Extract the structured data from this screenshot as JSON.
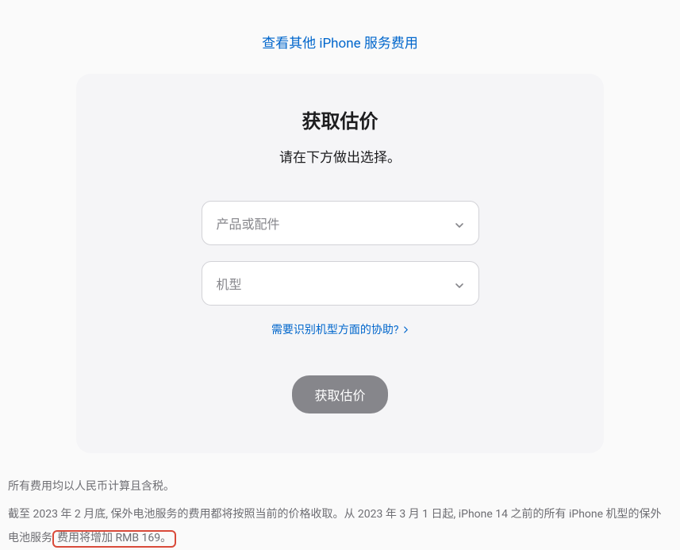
{
  "topLink": {
    "label": "查看其他 iPhone 服务费用"
  },
  "card": {
    "title": "获取估价",
    "subtitle": "请在下方做出选择。",
    "select1": {
      "placeholder": "产品或配件"
    },
    "select2": {
      "placeholder": "机型"
    },
    "helpLink": "需要识别机型方面的协助?",
    "button": "获取估价"
  },
  "footer": {
    "line1": "所有费用均以人民币计算且含税。",
    "line2_part1": "截至 2023 年 2 月底, 保外电池服务的费用都将按照当前的价格收取。从 2023 年 3 月 1 日起, iPhone 14 之前的所有 iPhone 机型的保外电池服务",
    "line2_highlight": "费用将增加 RMB 169。"
  }
}
